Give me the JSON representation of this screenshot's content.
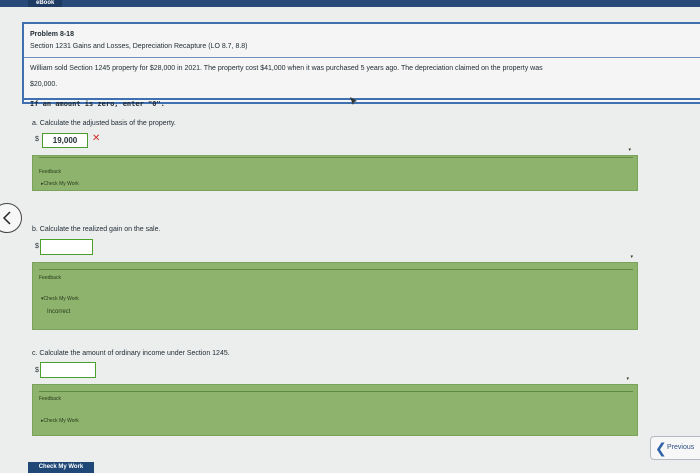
{
  "header": {
    "tab_label": "eBook"
  },
  "problem": {
    "title": "Problem 8-18",
    "subtitle": "Section 1231 Gains and Losses, Depreciation Recapture (LO 8.7, 8.8)",
    "body_line1": "William sold Section 1245 property for $28,000 in 2021. The property cost $41,000 when it was purchased 5 years ago. The depreciation claimed on the property was",
    "body_line2": "$20,000.",
    "note": "If an amount is zero, enter \"0\"."
  },
  "parts": [
    {
      "question": "a. Calculate the adjusted basis of the property.",
      "currency": "$",
      "answer": "19,000",
      "status_mark": "✕",
      "feedback_label": "Feedback",
      "check_label": "▸Check My Work",
      "feedback_message": ""
    },
    {
      "question": "b. Calculate the realized gain on the sale.",
      "currency": "$",
      "answer": "",
      "feedback_label": "Feedback",
      "check_label": "▾Check My Work",
      "feedback_message": "Incorrect"
    },
    {
      "question": "c. Calculate the amount of ordinary income under Section 1245.",
      "currency": "$",
      "answer": "",
      "feedback_label": "Feedback",
      "check_label": "▸Check My Work",
      "feedback_message": ""
    }
  ],
  "navigation": {
    "previous_label": "Previous",
    "check_work_button": "Check My Work"
  },
  "colors": {
    "accent_blue": "#3f70b0",
    "feedback_green": "#8db36c",
    "error_red": "#d0302a"
  }
}
